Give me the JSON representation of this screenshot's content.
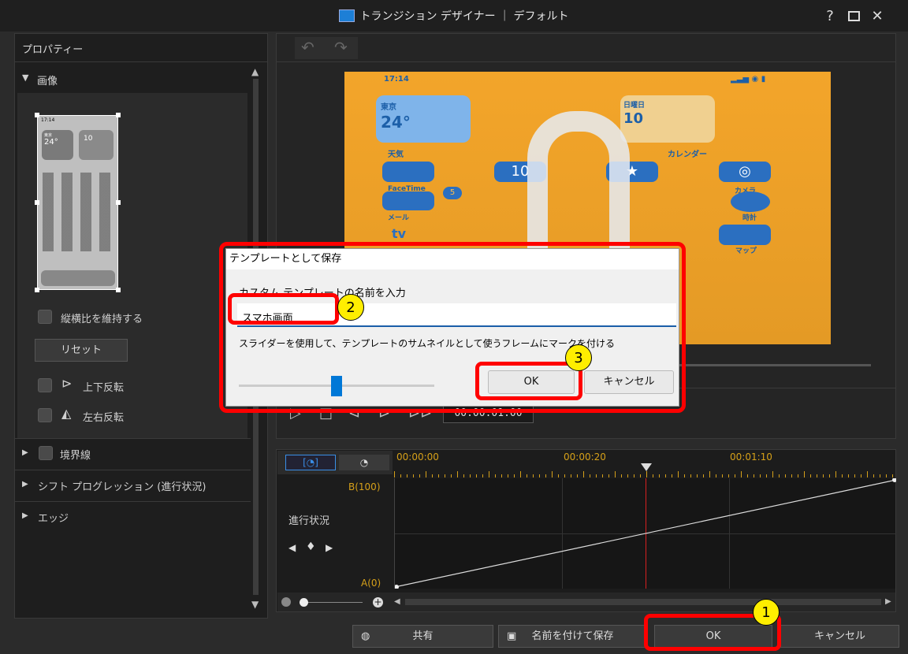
{
  "window": {
    "title": "トランジション デザイナー ｜ デフォルト",
    "help": "?",
    "maximize": "☐",
    "close": "✕"
  },
  "properties": {
    "header": "プロパティー",
    "image_section": "画像",
    "keep_aspect": "縦横比を維持する",
    "reset": "リセット",
    "flip_v": "上下反転",
    "flip_h": "左右反転",
    "border": "境界線",
    "shift": "シフト プログレッション (進行状況)",
    "edge": "エッジ"
  },
  "thumb": {
    "time": "17:14",
    "city": "東京",
    "temp": "24°",
    "date": "10"
  },
  "preview": {
    "time": "17:14",
    "city": "東京",
    "temp": "24°",
    "weekday": "日曜日",
    "day": "10",
    "weather": "天気",
    "calendar": "カレンダー",
    "cal_tile": "10",
    "facetime": "FaceTime",
    "mail": "メール",
    "clock": "時計",
    "maps": "マップ",
    "camera": "カメラ",
    "tv": "tv",
    "badge": "5"
  },
  "playback": {
    "timecode": "00:00:01:00"
  },
  "timeline": {
    "t0": "00:00:00",
    "t1": "00:00:20",
    "t2": "00:01:10",
    "b_label": "B(100)",
    "a_label": "A(0)",
    "track": "進行状況"
  },
  "dialog": {
    "title": "テンプレートとして保存",
    "prompt": "カスタム テンプレートの名前を入力",
    "value": "スマホ画面",
    "hint": "スライダーを使用して、テンプレートのサムネイルとして使うフレームにマークを付ける",
    "ok": "OK",
    "cancel": "キャンセル",
    "slider_fraction": 0.5
  },
  "bottom": {
    "share": "共有",
    "save_as": "名前を付けて保存",
    "ok": "OK",
    "cancel": "キャンセル"
  },
  "callouts": {
    "c1": "1",
    "c2": "2",
    "c3": "3"
  }
}
